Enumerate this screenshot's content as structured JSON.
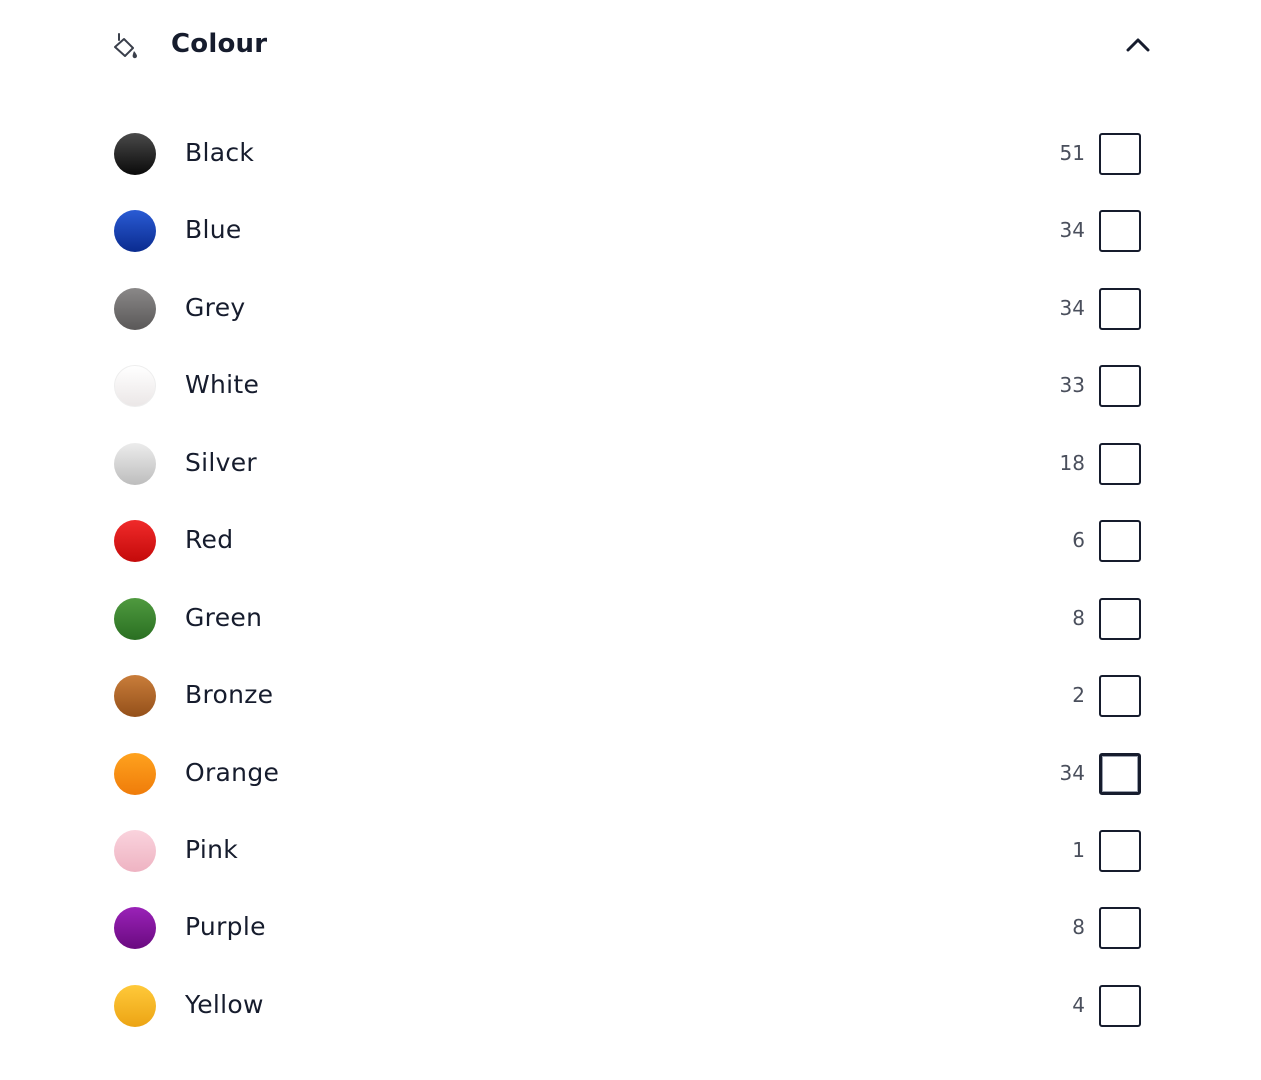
{
  "filter": {
    "title": "Colour",
    "icon": "paint-bucket-icon",
    "expanded": true,
    "toggle_icon": "chevron-up-icon"
  },
  "options": [
    {
      "label": "Black",
      "count": "51",
      "checked": false,
      "top": "#4a4a4a",
      "bottom": "#0a0a0a"
    },
    {
      "label": "Blue",
      "count": "34",
      "checked": false,
      "top": "#2a5bd4",
      "bottom": "#0a2b8f"
    },
    {
      "label": "Grey",
      "count": "34",
      "checked": false,
      "top": "#8a8888",
      "bottom": "#5a5858"
    },
    {
      "label": "White",
      "count": "33",
      "checked": false,
      "top": "#ffffff",
      "bottom": "#ebe7e7"
    },
    {
      "label": "Silver",
      "count": "18",
      "checked": false,
      "top": "#ececec",
      "bottom": "#bdbdbd"
    },
    {
      "label": "Red",
      "count": "6",
      "checked": false,
      "top": "#f02a2a",
      "bottom": "#c40a0a"
    },
    {
      "label": "Green",
      "count": "8",
      "checked": false,
      "top": "#4f9a3f",
      "bottom": "#2a6f22"
    },
    {
      "label": "Bronze",
      "count": "2",
      "checked": false,
      "top": "#c97d3a",
      "bottom": "#94501a"
    },
    {
      "label": "Orange",
      "count": "34",
      "checked": false,
      "top": "#ffa21e",
      "bottom": "#ef7c0a",
      "focused": true
    },
    {
      "label": "Pink",
      "count": "1",
      "checked": false,
      "top": "#fad3dd",
      "bottom": "#eeb3c2"
    },
    {
      "label": "Purple",
      "count": "8",
      "checked": false,
      "top": "#9a22b8",
      "bottom": "#6a0a80"
    },
    {
      "label": "Yellow",
      "count": "4",
      "checked": false,
      "top": "#ffc93a",
      "bottom": "#eca414"
    }
  ]
}
